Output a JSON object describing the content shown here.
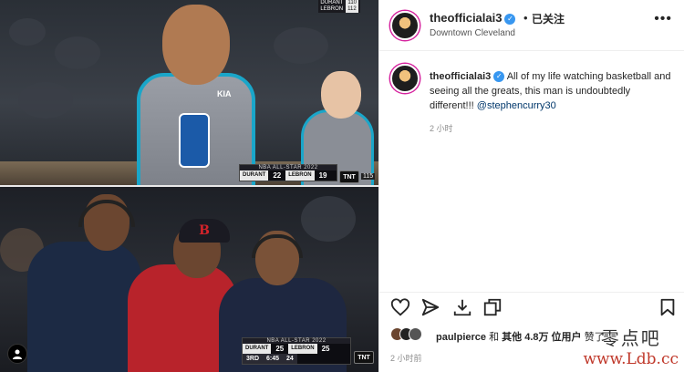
{
  "media": {
    "top_scorebug": {
      "title": "NBA ALL-STAR 2022",
      "team_a": "DURANT",
      "team_b": "LEBRON",
      "score_a": "22",
      "score_b": "19",
      "network": "TNT",
      "corner_num": "115"
    },
    "top_corner_score": {
      "team_a": "DURANT",
      "team_b": "LEBRON",
      "score_a": "110",
      "score_b": "112"
    },
    "bottom_scorebug": {
      "title": "NBA ALL-STAR 2022",
      "team_a": "DURANT",
      "team_b": "LEBRON",
      "score_a": "25",
      "score_b": "25",
      "quarter": "3RD",
      "clock": "6:45",
      "shot_clock": "24",
      "network": "TNT"
    },
    "jersey_brand": "KIA",
    "cap_logo": "B",
    "user_badge_icon": "user-icon"
  },
  "header": {
    "username": "theofficialai3",
    "dot": "•",
    "follow_label": "已关注",
    "location": "Downtown Cleveland",
    "more_icon": "more-horizontal-icon"
  },
  "caption": {
    "username": "theofficialai3",
    "text": "All of my life watching basketball and seeing all the greats, this man is undoubtedly different!!! ",
    "mention": "@stephencurry30",
    "time": "2 小时"
  },
  "actions": {
    "like_icon": "heart-icon",
    "comment_icon": "comment-icon",
    "share_icon": "send-icon",
    "save_icon": "bookmark-icon",
    "copy_icon": "copy-icon"
  },
  "likes": {
    "first_user": "paulpierce",
    "mid": " 和 ",
    "others": "其他 4.8万 位用户",
    "suffix": " 赞了"
  },
  "posted": "2 小时前",
  "watermark": {
    "cn": "零点吧",
    "url": "www.Ldb.cc"
  },
  "colors": {
    "accent_blue": "#3897f0",
    "mention": "#00376b",
    "muted": "#8e8e8e",
    "watermark_red": "#c0392b"
  }
}
